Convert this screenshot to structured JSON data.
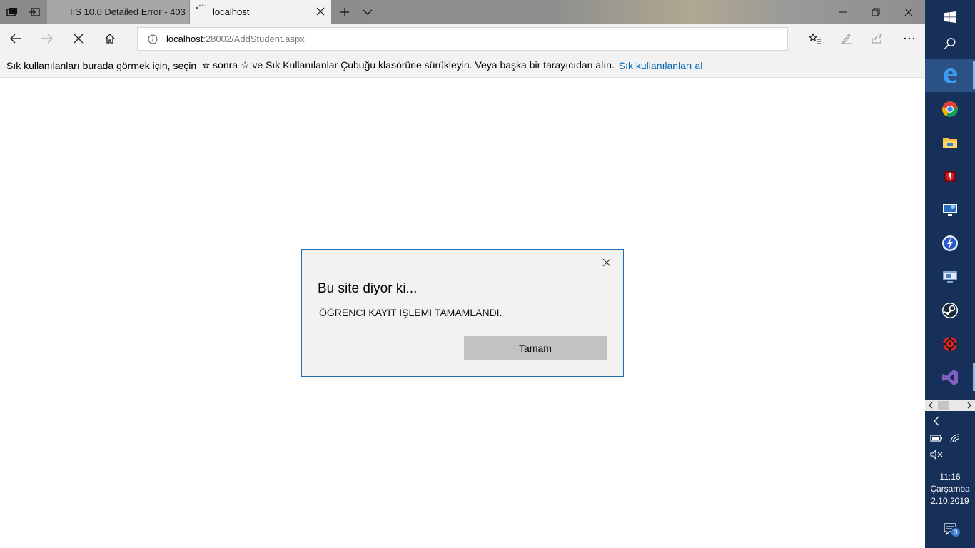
{
  "tabs": [
    {
      "title": "IIS 10.0 Detailed Error - 403",
      "active": false
    },
    {
      "title": "localhost",
      "active": true
    }
  ],
  "address": {
    "host": "localhost",
    "path": ":28002/AddStudent.aspx"
  },
  "favorites_bar": {
    "text_before": "Sık kullanılanları burada görmek için, seçin",
    "star_glyph": "✮",
    "text_middle": "sonra ☆ ve Sık Kullanılanlar Çubuğu klasörüne sürükleyin. Veya başka bir tarayıcıdan alın.",
    "link": "Sık kullanılanları al"
  },
  "dialog": {
    "title": "Bu site diyor ki...",
    "message": "ÖĞRENCİ KAYIT İŞLEMİ TAMAMLANDI.",
    "ok_label": "Tamam"
  },
  "taskbar": {
    "apps": [
      "windows-start",
      "search",
      "edge",
      "chrome",
      "file-explorer",
      "app-red",
      "remote-desktop",
      "app-bolt",
      "app-monitor",
      "steam",
      "app-red-gear",
      "visual-studio"
    ],
    "clock": {
      "time": "11:16",
      "day": "Çarşamba",
      "date": "2.10.2019"
    },
    "notifications": "3"
  },
  "colors": {
    "accent": "#1e6fb3",
    "link": "#0063b1",
    "taskbar": "#16305a"
  }
}
